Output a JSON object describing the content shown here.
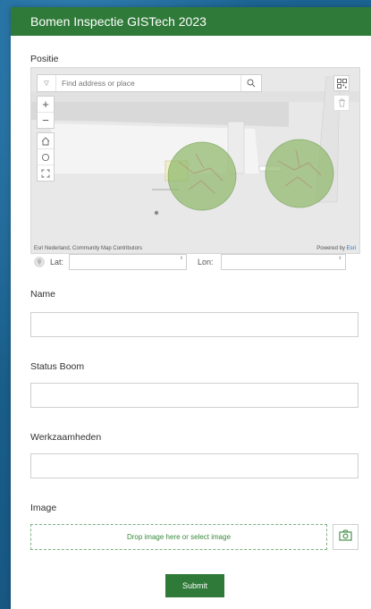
{
  "form": {
    "title": "Bomen Inspectie GISTech 2023",
    "position_label": "Positie",
    "fields": [
      {
        "label": "Name",
        "value": ""
      },
      {
        "label": "Status Boom",
        "value": ""
      },
      {
        "label": "Werkzaamheden",
        "value": ""
      }
    ],
    "image_label": "Image",
    "dropzone_text": "Drop image here or select image",
    "submit_label": "Submit"
  },
  "map": {
    "search_placeholder": "Find address or place",
    "attribution": "Esri Nederland, Community Map Contributors",
    "powered_by": "Powered by",
    "powered_brand": "Esri",
    "lat_label": "Lat:",
    "lon_label": "Lon:",
    "lat_value": "",
    "lon_value": ""
  },
  "icons": [
    "chevron-down-icon",
    "search-icon",
    "zoom-in-icon",
    "zoom-out-icon",
    "home-icon",
    "locate-icon",
    "fullscreen-icon",
    "qr-code-icon",
    "trash-icon",
    "location-pin-icon",
    "camera-icon"
  ],
  "colors": {
    "accent": "#2f7a39",
    "background": "#1d5f8c",
    "dropzone": "#3a8a3c"
  }
}
